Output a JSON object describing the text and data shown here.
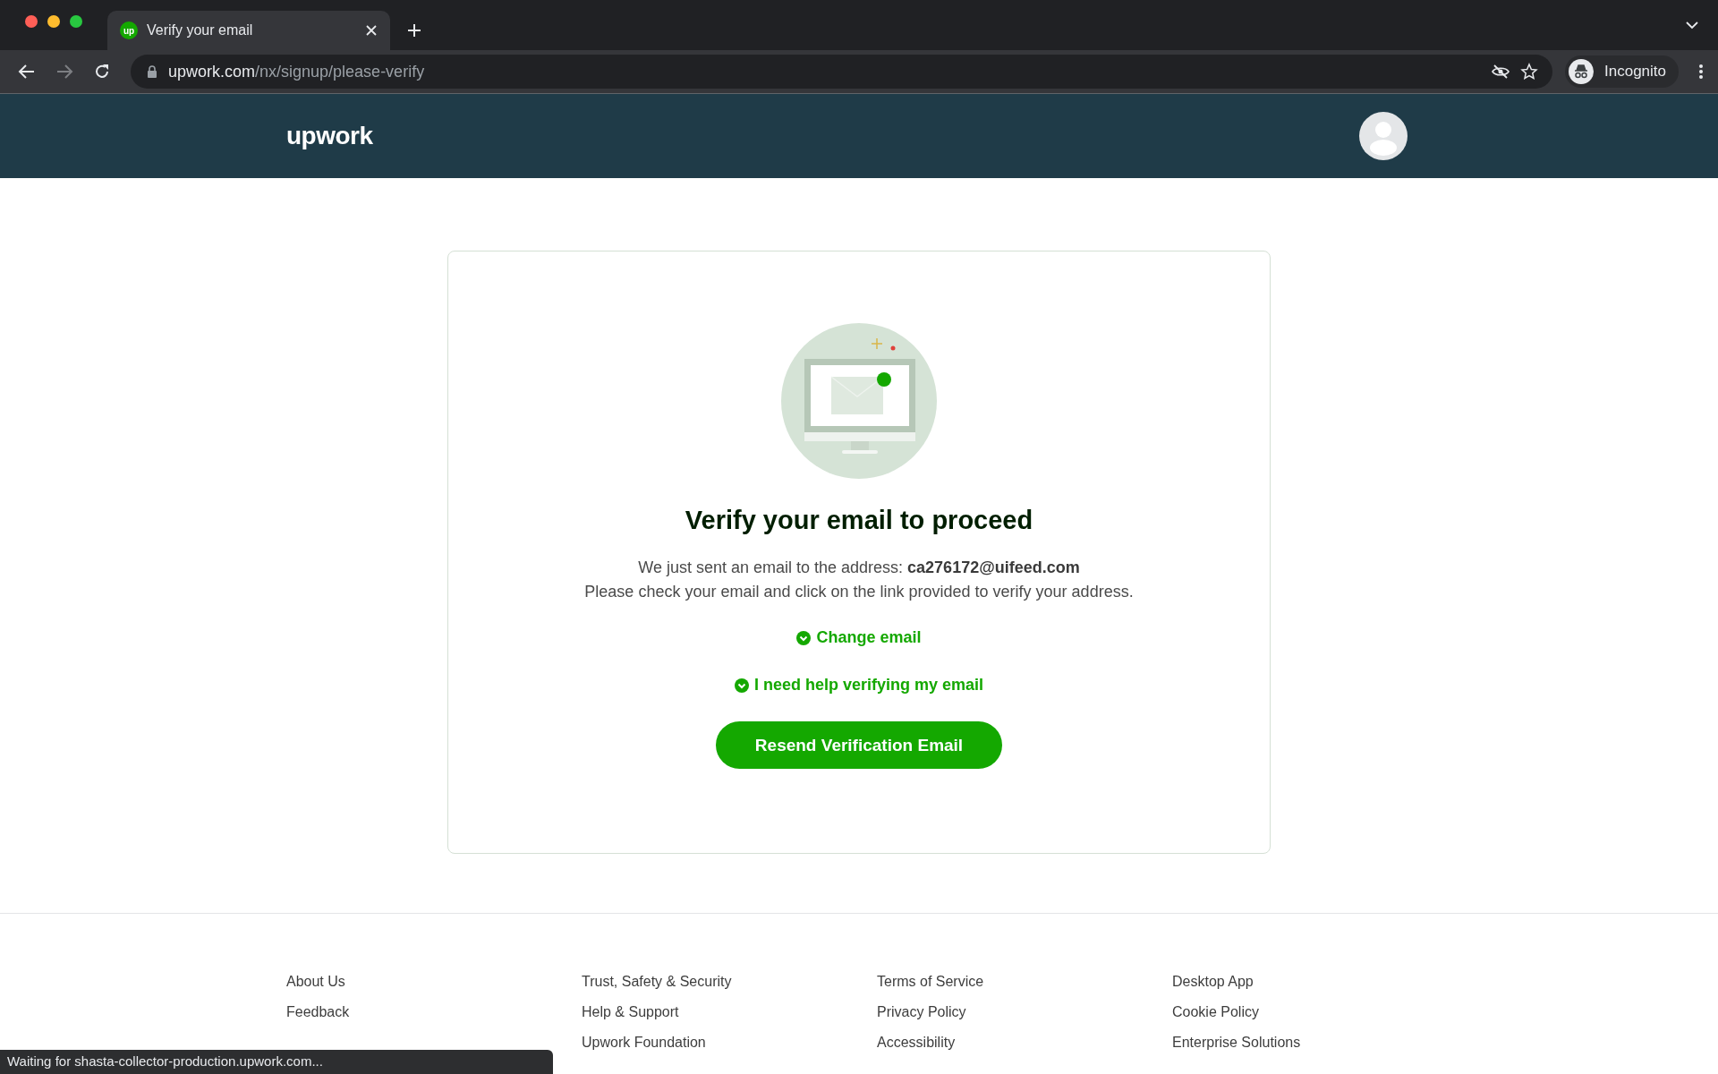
{
  "browser": {
    "tab": {
      "favicon_text": "up",
      "title": "Verify your email",
      "selected": true
    },
    "url": {
      "host": "upwork.com",
      "path": "/nx/signup/please-verify"
    },
    "profile": "Incognito",
    "status_text": "Waiting for shasta-collector-production.upwork.com..."
  },
  "header": {
    "logo": "upwork"
  },
  "card": {
    "title": "Verify your email to proceed",
    "message": [
      "We just sent an email to the address: **ca276172@uifeed.com**",
      "Please check your email and click on the link provided to verify your address."
    ],
    "links": [
      "Change email",
      "I need help verifying my email"
    ],
    "button": "Resend Verification Email"
  },
  "footer": {
    "columns": [
      [
        "About Us",
        "Feedback"
      ],
      [
        "Trust, Safety & Security",
        "Help & Support",
        "Upwork Foundation"
      ],
      [
        "Terms of Service",
        "Privacy Policy",
        "Accessibility"
      ],
      [
        "Desktop App",
        "Cookie Policy",
        "Enterprise Solutions"
      ]
    ]
  }
}
